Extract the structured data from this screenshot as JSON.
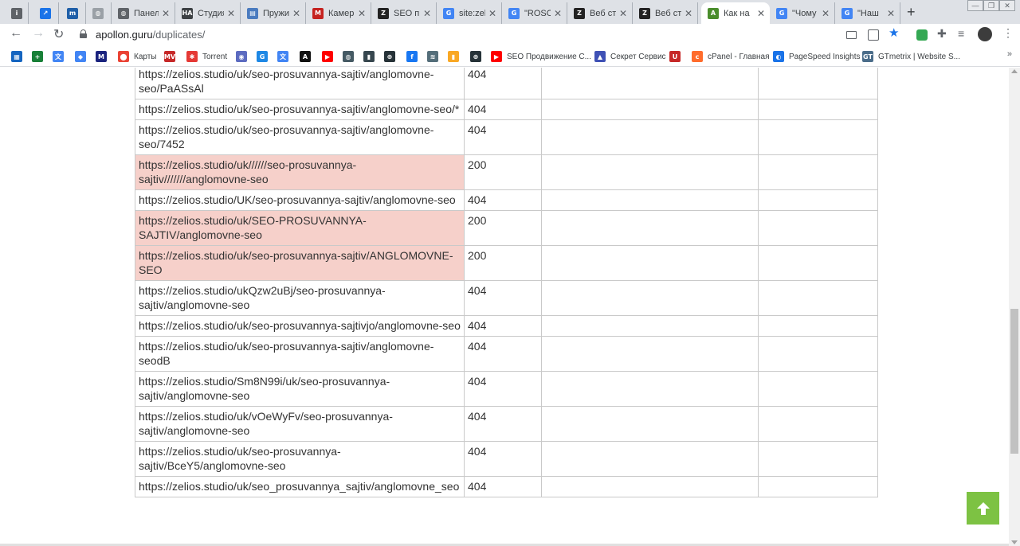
{
  "browser": {
    "tabs": [
      {
        "title": "",
        "icon": "info-icon",
        "color": "#5f6368",
        "glyph": "i"
      },
      {
        "title": "",
        "icon": "analytics-icon",
        "color": "#1a73e8",
        "glyph": "↗"
      },
      {
        "title": "",
        "icon": "m-logo-icon",
        "color": "#1f5fa8",
        "glyph": "m"
      },
      {
        "title": "",
        "icon": "globe-icon",
        "color": "#9aa0a6",
        "glyph": "◍"
      },
      {
        "title": "Панель",
        "icon": "globe-icon",
        "color": "#5f6368",
        "glyph": "◍"
      },
      {
        "title": "Студия",
        "icon": "ha-icon",
        "color": "#3c4043",
        "glyph": "HA"
      },
      {
        "title": "Пружи",
        "icon": "doc-icon",
        "color": "#4a7bbf",
        "glyph": "▤"
      },
      {
        "title": "Камер",
        "icon": "gmail-icon",
        "color": "#c5221f",
        "glyph": "M"
      },
      {
        "title": "SEO пр",
        "icon": "z-logo-icon",
        "color": "#222222",
        "glyph": "Z"
      },
      {
        "title": "site:zel",
        "icon": "google-icon",
        "color": "#4285f4",
        "glyph": "G"
      },
      {
        "title": "\"ROSO",
        "icon": "google-icon",
        "color": "#4285f4",
        "glyph": "G"
      },
      {
        "title": "Веб ст",
        "icon": "z-logo-icon",
        "color": "#222222",
        "glyph": "Z"
      },
      {
        "title": "Веб ст",
        "icon": "z-logo-icon",
        "color": "#222222",
        "glyph": "Z"
      },
      {
        "title": "Как на",
        "icon": "apollon-icon",
        "color": "#4a8d2c",
        "glyph": "A"
      },
      {
        "title": "\"Чому",
        "icon": "google-icon",
        "color": "#4285f4",
        "glyph": "G"
      },
      {
        "title": "\"Наш",
        "icon": "google-icon",
        "color": "#4285f4",
        "glyph": "G"
      }
    ],
    "active_tab": 13,
    "address": {
      "host": "apollon.guru",
      "path": "/duplicates/"
    },
    "bookmarks": [
      {
        "label": "",
        "icon": "apps-icon",
        "color": "#1565c0",
        "glyph": "▦"
      },
      {
        "label": "",
        "icon": "plus-icon",
        "color": "#188038",
        "glyph": "+"
      },
      {
        "label": "",
        "icon": "translate-icon",
        "color": "#4285f4",
        "glyph": "文"
      },
      {
        "label": "",
        "icon": "drop-icon",
        "color": "#4285f4",
        "glyph": "◆"
      },
      {
        "label": "",
        "icon": "chart-icon",
        "color": "#1a237e",
        "glyph": "M"
      },
      {
        "label": "Карты",
        "icon": "maps-icon",
        "color": "#ea4335",
        "glyph": "⬤"
      },
      {
        "label": "",
        "icon": "mv-icon",
        "color": "#c62828",
        "glyph": "MV"
      },
      {
        "label": "Torrent",
        "icon": "torrent-icon",
        "color": "#e53935",
        "glyph": "✱"
      },
      {
        "label": "",
        "icon": "eye-icon",
        "color": "#5c6bc0",
        "glyph": "◉"
      },
      {
        "label": "",
        "icon": "g-icon",
        "color": "#1e88e5",
        "glyph": "G"
      },
      {
        "label": "",
        "icon": "translate-icon",
        "color": "#4285f4",
        "glyph": "文"
      },
      {
        "label": "",
        "icon": "a-icon",
        "color": "#111111",
        "glyph": "A"
      },
      {
        "label": "",
        "icon": "youtube-icon",
        "color": "#ff0000",
        "glyph": "▶"
      },
      {
        "label": "",
        "icon": "globe-icon",
        "color": "#455a64",
        "glyph": "◍"
      },
      {
        "label": "",
        "icon": "bookmark-icon",
        "color": "#37474f",
        "glyph": "▮"
      },
      {
        "label": "",
        "icon": "globe-icon",
        "color": "#263238",
        "glyph": "⊕"
      },
      {
        "label": "",
        "icon": "facebook-icon",
        "color": "#1877f2",
        "glyph": "f"
      },
      {
        "label": "",
        "icon": "wifi-icon",
        "color": "#546e7a",
        "glyph": "≋"
      },
      {
        "label": "",
        "icon": "bar-chart-icon",
        "color": "#f9a825",
        "glyph": "▮"
      },
      {
        "label": "",
        "icon": "globe-icon",
        "color": "#263238",
        "glyph": "⊕"
      },
      {
        "label": "SEO Продвижение С...",
        "icon": "youtube-icon",
        "color": "#ff0000",
        "glyph": "▶"
      },
      {
        "label": "Секрет Сервис",
        "icon": "service-icon",
        "color": "#3f51b5",
        "glyph": "▲"
      },
      {
        "label": "",
        "icon": "u-icon",
        "color": "#c62828",
        "glyph": "U"
      },
      {
        "label": "cPanel - Главная",
        "icon": "cpanel-icon",
        "color": "#ff6c2c",
        "glyph": "c"
      },
      {
        "label": "PageSpeed Insights",
        "icon": "pagespeed-icon",
        "color": "#1a73e8",
        "glyph": "◐"
      },
      {
        "label": "GTmetrix | Website S...",
        "icon": "gtmetrix-icon",
        "color": "#4b6d8a",
        "glyph": "GT"
      }
    ]
  },
  "duplicates_table": {
    "rows": [
      {
        "url": "https://zelios.studio/uk/seo-prosuvannya-sajtiv/anglomovne-seo/PaASsAl",
        "status": "404",
        "highlight": false
      },
      {
        "url": "https://zelios.studio/uk/seo-prosuvannya-sajtiv/anglomovne-seo/*",
        "status": "404",
        "highlight": false
      },
      {
        "url": "https://zelios.studio/uk/seo-prosuvannya-sajtiv/anglomovne-seo/7452",
        "status": "404",
        "highlight": false
      },
      {
        "url": "https://zelios.studio/uk//////seo-prosuvannya-sajtiv///////anglomovne-seo",
        "status": "200",
        "highlight": true
      },
      {
        "url": "https://zelios.studio/UK/seo-prosuvannya-sajtiv/anglomovne-seo",
        "status": "404",
        "highlight": false
      },
      {
        "url": "https://zelios.studio/uk/SEO-PROSUVANNYA-SAJTIV/anglomovne-seo",
        "status": "200",
        "highlight": true
      },
      {
        "url": "https://zelios.studio/uk/seo-prosuvannya-sajtiv/ANGLOMOVNE-SEO",
        "status": "200",
        "highlight": true
      },
      {
        "url": "https://zelios.studio/ukQzw2uBj/seo-prosuvannya-sajtiv/anglomovne-seo",
        "status": "404",
        "highlight": false
      },
      {
        "url": "https://zelios.studio/uk/seo-prosuvannya-sajtivjo/anglomovne-seo",
        "status": "404",
        "highlight": false
      },
      {
        "url": "https://zelios.studio/uk/seo-prosuvannya-sajtiv/anglomovne-seodB",
        "status": "404",
        "highlight": false
      },
      {
        "url": "https://zelios.studio/Sm8N99i/uk/seo-prosuvannya-sajtiv/anglomovne-seo",
        "status": "404",
        "highlight": false
      },
      {
        "url": "https://zelios.studio/uk/vOeWyFv/seo-prosuvannya-sajtiv/anglomovne-seo",
        "status": "404",
        "highlight": false
      },
      {
        "url": "https://zelios.studio/uk/seo-prosuvannya-sajtiv/BceY5/anglomovne-seo",
        "status": "404",
        "highlight": false
      },
      {
        "url": "https://zelios.studio/uk/seo_prosuvannya_sajtiv/anglomovne_seo",
        "status": "404",
        "highlight": false
      }
    ]
  },
  "colors": {
    "highlight_row": "#f6d0ca",
    "scroll_top_button": "#7dc243"
  }
}
